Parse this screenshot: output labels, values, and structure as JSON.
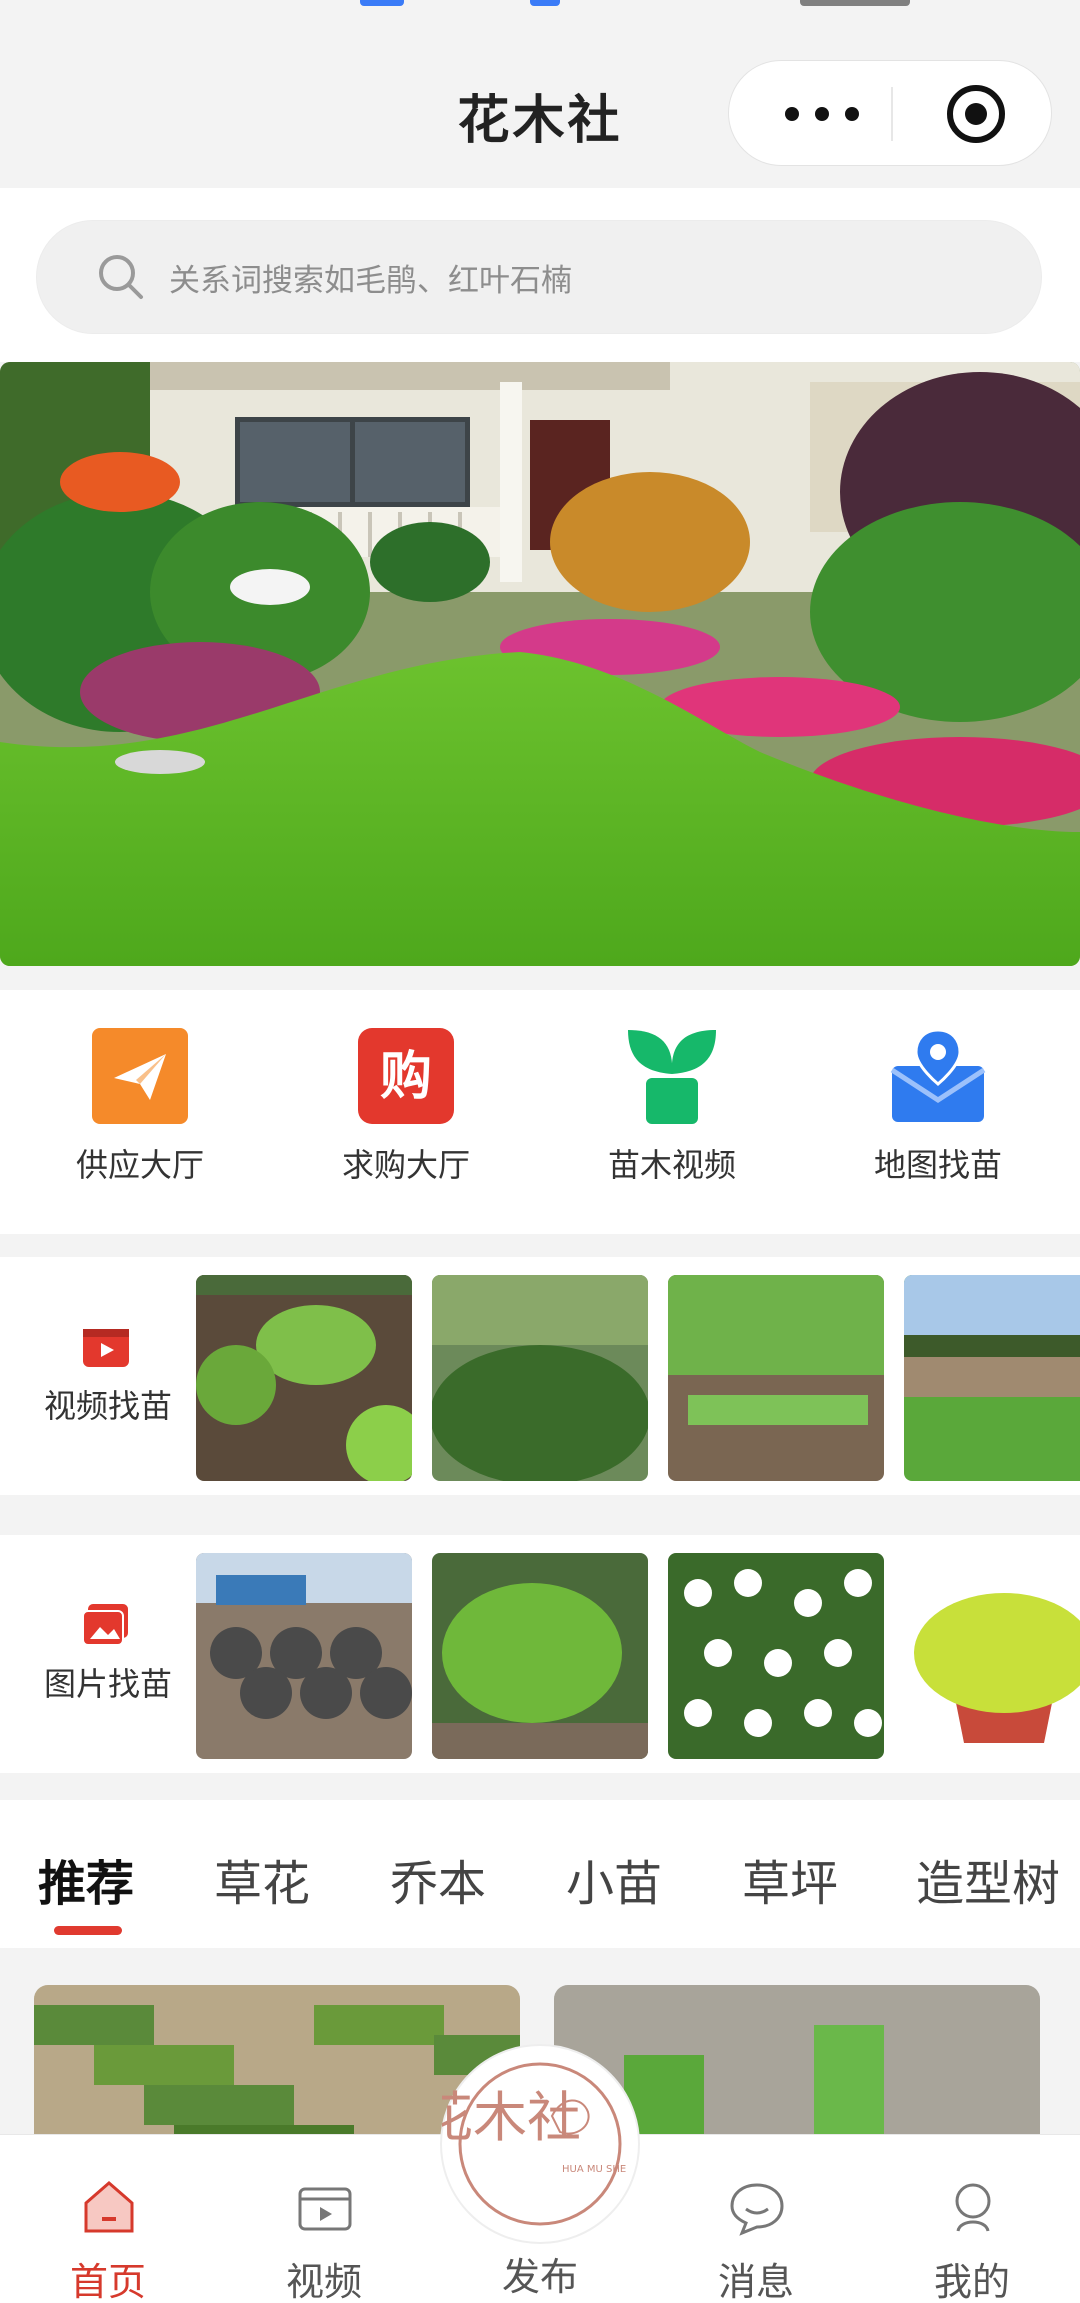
{
  "header": {
    "title": "花木社",
    "more_icon": "more-dots-icon",
    "close_icon": "target-close-icon"
  },
  "search": {
    "placeholder": "关系词搜索如毛鹃、红叶石楠",
    "icon": "search-icon"
  },
  "banner": {
    "alt": "garden-house-photo"
  },
  "quick_menu": [
    {
      "label": "供应大厅",
      "icon": "paper-plane-icon",
      "color": "#f58a2a"
    },
    {
      "label": "求购大厅",
      "icon": "buy-icon",
      "color": "#e3382d",
      "glyph": "购"
    },
    {
      "label": "苗木视频",
      "icon": "sprout-icon",
      "color": "#16b86a"
    },
    {
      "label": "地图找苗",
      "icon": "map-pin-icon",
      "color": "#2f7bef"
    }
  ],
  "video_find": {
    "label": "视频找苗",
    "icon": "video-icon"
  },
  "image_find": {
    "label": "图片找苗",
    "icon": "image-icon"
  },
  "tabs": [
    "推荐",
    "草花",
    "乔本",
    "小苗",
    "草坪",
    "造型树"
  ],
  "active_tab": "推荐",
  "bottom_nav": [
    {
      "label": "首页",
      "icon": "home-icon",
      "active": true
    },
    {
      "label": "视频",
      "icon": "video-clapper-icon",
      "active": false
    },
    {
      "label": "发布",
      "icon": "publish-logo",
      "active": false
    },
    {
      "label": "消息",
      "icon": "chat-bubble-icon",
      "active": false
    },
    {
      "label": "我的",
      "icon": "user-icon",
      "active": false
    }
  ],
  "publish_logo": {
    "text_main": "花木社",
    "text_sub": "HUA MU SHE"
  },
  "colors": {
    "accent": "#d6392c",
    "bg": "#f3f3f3"
  }
}
